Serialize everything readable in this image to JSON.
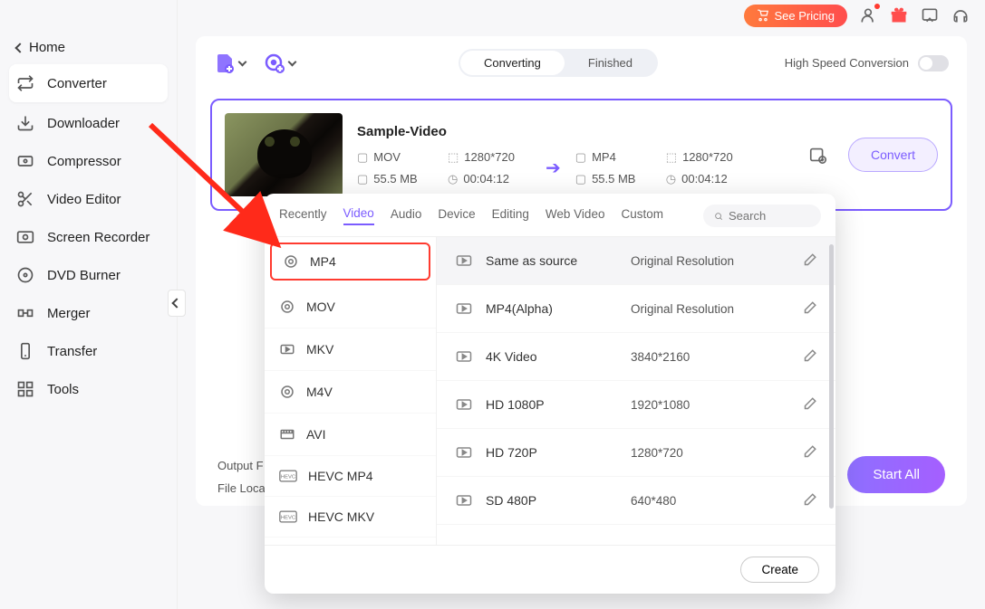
{
  "sidebar": {
    "home": "Home",
    "items": [
      {
        "label": "Converter"
      },
      {
        "label": "Downloader"
      },
      {
        "label": "Compressor"
      },
      {
        "label": "Video Editor"
      },
      {
        "label": "Screen Recorder"
      },
      {
        "label": "DVD Burner"
      },
      {
        "label": "Merger"
      },
      {
        "label": "Transfer"
      },
      {
        "label": "Tools"
      }
    ]
  },
  "header": {
    "pricing": "See Pricing"
  },
  "toolbar": {
    "segments": {
      "converting": "Converting",
      "finished": "Finished"
    },
    "hsc": "High Speed Conversion"
  },
  "video": {
    "title": "Sample-Video",
    "src": {
      "format": "MOV",
      "resolution": "1280*720",
      "size": "55.5 MB",
      "duration": "00:04:12"
    },
    "dst": {
      "format": "MP4",
      "resolution": "1280*720",
      "size": "55.5 MB",
      "duration": "00:04:12"
    },
    "convert": "Convert"
  },
  "footer": {
    "output": "Output F",
    "location": "File Loca",
    "startall": "Start All"
  },
  "popover": {
    "tabs": [
      "Recently",
      "Video",
      "Audio",
      "Device",
      "Editing",
      "Web Video",
      "Custom"
    ],
    "search_placeholder": "Search",
    "formats": [
      "MP4",
      "MOV",
      "MKV",
      "M4V",
      "AVI",
      "HEVC MP4",
      "HEVC MKV"
    ],
    "resolutions": [
      {
        "name": "Same as source",
        "value": "Original Resolution"
      },
      {
        "name": "MP4(Alpha)",
        "value": "Original Resolution"
      },
      {
        "name": "4K Video",
        "value": "3840*2160"
      },
      {
        "name": "HD 1080P",
        "value": "1920*1080"
      },
      {
        "name": "HD 720P",
        "value": "1280*720"
      },
      {
        "name": "SD 480P",
        "value": "640*480"
      }
    ],
    "create": "Create"
  }
}
